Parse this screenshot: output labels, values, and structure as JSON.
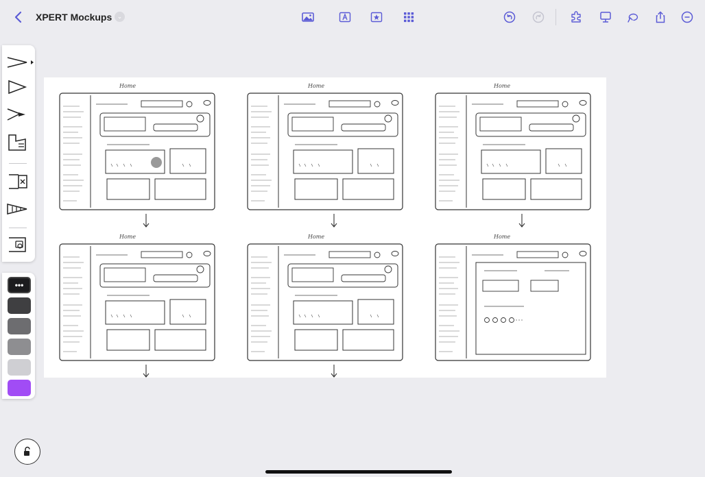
{
  "app": {
    "document_title": "XPERT Mockups"
  },
  "toolbar": {
    "left": [
      "back-chevron-icon",
      "title-menu-chevron-icon"
    ],
    "center": [
      "image-icon",
      "text-box-icon",
      "sticker-icon",
      "grid-icon"
    ],
    "right": [
      "undo-icon",
      "redo-icon",
      "extensions-icon",
      "present-icon",
      "lasso-icon",
      "share-icon",
      "more-icon"
    ]
  },
  "palette": {
    "tools": [
      "pen-tool-icon",
      "marker-tool-icon",
      "fountain-pen-tool-icon",
      "highlighter-tool-icon",
      "eraser-tool-icon",
      "spray-tool-icon",
      "shape-tool-icon"
    ],
    "swatches": [
      {
        "color": "#1c1c1e",
        "selected": true,
        "label": "•••"
      },
      {
        "color": "#3f3f41",
        "selected": false
      },
      {
        "color": "#6d6d70",
        "selected": false
      },
      {
        "color": "#8e8e91",
        "selected": false
      },
      {
        "color": "#cfcfd3",
        "selected": false
      },
      {
        "color": "#a14cf5",
        "selected": false
      }
    ]
  },
  "canvas": {
    "frames": [
      {
        "label": "Home"
      },
      {
        "label": "Home"
      },
      {
        "label": "Home"
      },
      {
        "label": "Home"
      },
      {
        "label": "Home"
      },
      {
        "label": "Home"
      }
    ]
  },
  "colors": {
    "accent": "#5b5bd6",
    "background": "#ececf0"
  }
}
